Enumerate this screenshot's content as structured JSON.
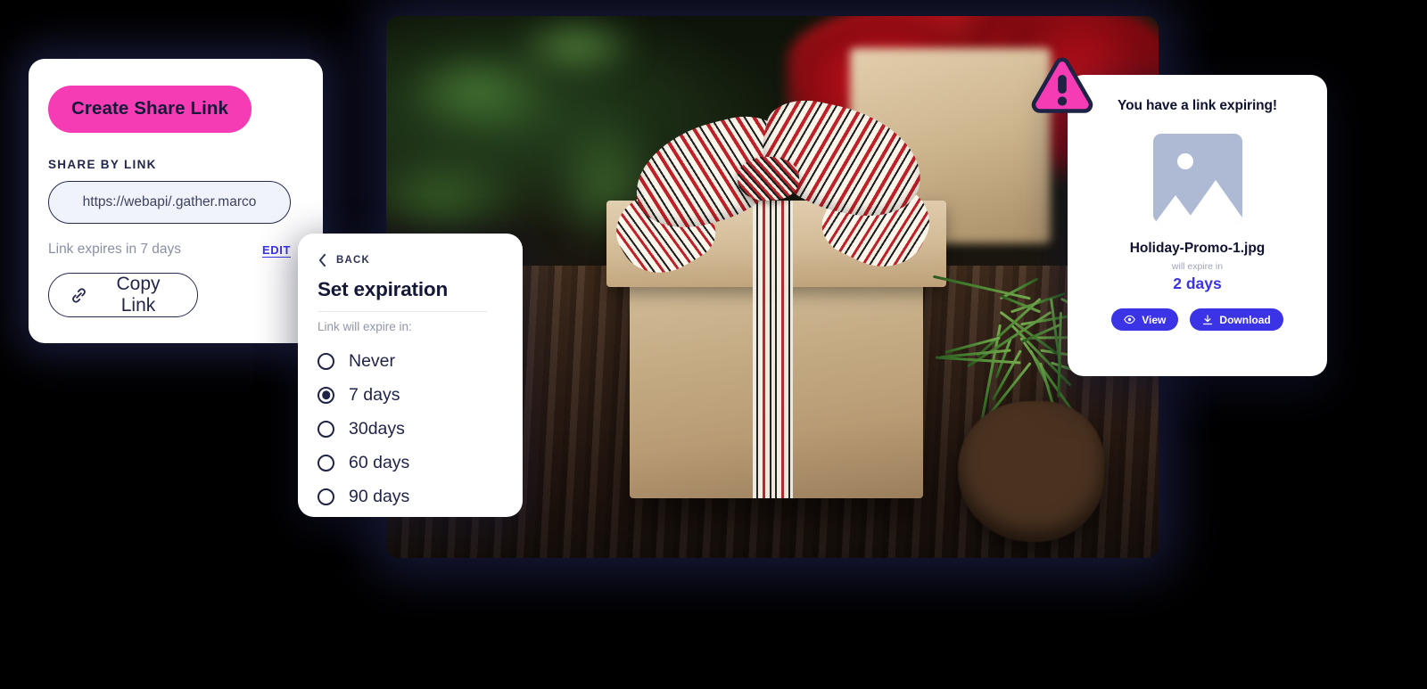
{
  "share_card": {
    "create_button_label": "Create Share Link",
    "section_label": "SHARE BY LINK",
    "link_value": "https://webapi/.gather.marco",
    "link_placeholder": "https://webapi/.gather.marco",
    "expiry_text": "Link expires in 7 days",
    "edit_label": "EDIT",
    "copy_button_label": "Copy Link",
    "copy_icon": "link-chain-icon",
    "accent_pink": "#F53CB4",
    "accent_indigo": "#3B33E6",
    "navy": "#22264C"
  },
  "expiration_card": {
    "back_label": "BACK",
    "back_icon": "chevron-left-icon",
    "title": "Set expiration",
    "sub_label": "Link will expire in:",
    "selected": "7 days",
    "options": [
      {
        "label": "Never",
        "checked": false
      },
      {
        "label": "7 days",
        "checked": true
      },
      {
        "label": "30days",
        "checked": false
      },
      {
        "label": "60 days",
        "checked": false
      },
      {
        "label": "90 days",
        "checked": false
      }
    ]
  },
  "notification_card": {
    "warning_icon": "warning-triangle-icon",
    "title": "You have a link expiring!",
    "thumbnail_icon": "image-placeholder-icon",
    "file_name": "Holiday-Promo-1.jpg",
    "expire_note": "will expire in",
    "expire_days": "2 days",
    "view_button_label": "View",
    "view_icon": "eye-icon",
    "download_button_label": "Download",
    "download_icon": "download-arrow-icon",
    "button_color": "#3B33E6",
    "warning_color": "#F53CB4"
  },
  "photo": {
    "alt_name": "gift-box-photo"
  }
}
